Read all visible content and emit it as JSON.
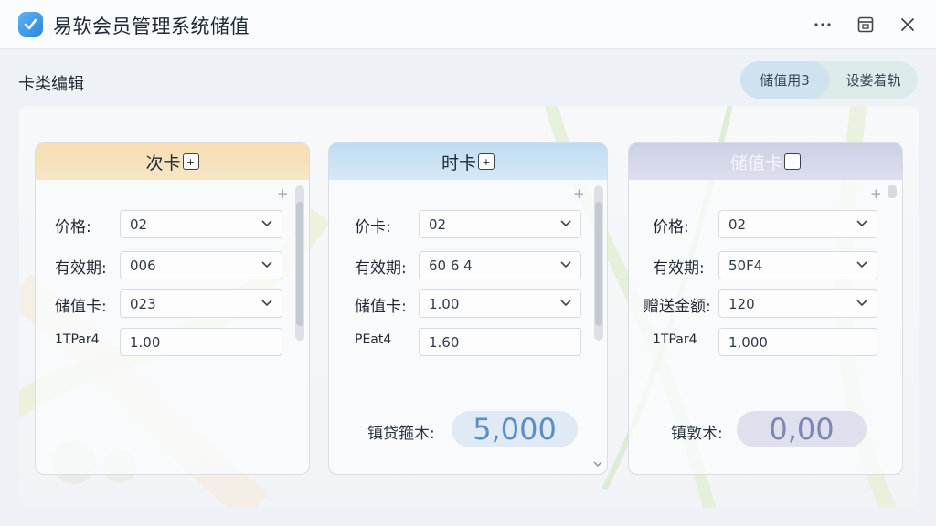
{
  "window": {
    "title": "易软会员管理系统储值",
    "controls": [
      "more-icon",
      "restore-icon",
      "close-icon"
    ]
  },
  "toolbar": {
    "section_title": "卡类编辑",
    "tabs": [
      {
        "label": "储值用3",
        "active": true
      },
      {
        "label": "设娄着轨",
        "active": false
      }
    ]
  },
  "cards": [
    {
      "title": "次卡",
      "rows": [
        {
          "label": "价格:",
          "value": "02"
        },
        {
          "label": "有效期:",
          "value": "006"
        },
        {
          "label": "储值卡:",
          "value": "023"
        }
      ],
      "extra_label": "1TPar4",
      "extra_value": "1.00"
    },
    {
      "title": "时卡",
      "rows": [
        {
          "label": "价卡:",
          "value": "02"
        },
        {
          "label": "有效期:",
          "value": "60 6 4"
        },
        {
          "label": "储值卡:",
          "value": "1.00"
        }
      ],
      "extra_label": "PEat4",
      "extra_value": "1.60",
      "total_label": "镇贷箍木:",
      "total_value": "5,000"
    },
    {
      "title": "储值卡",
      "rows": [
        {
          "label": "价格:",
          "value": "02"
        },
        {
          "label": "有效期:",
          "value": "50F4"
        },
        {
          "label": "赠送金额:",
          "value": "120"
        }
      ],
      "extra_label": "1TPar4",
      "extra_value": "1,000",
      "total_label": "镇敦术:",
      "total_value": "0,00"
    }
  ],
  "colors": {
    "accent_blue": "#2c86e0",
    "card1_header": "#f9ddb0",
    "card2_header": "#bfdcf2",
    "card3_header": "#cdcfe6"
  }
}
